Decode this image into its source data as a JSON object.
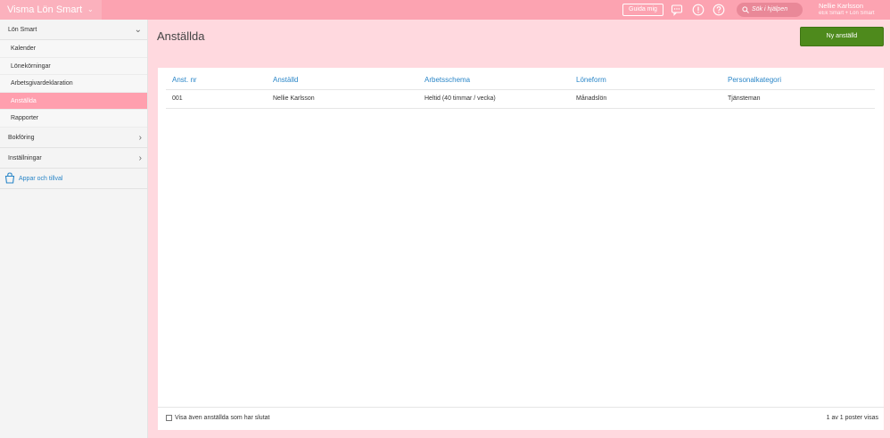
{
  "app": {
    "title": "Visma Lön Smart"
  },
  "topbar": {
    "guide_label": "Guida mig",
    "search_placeholder": "Sök i hjälpen",
    "user_name": "Nellie Karlsson",
    "user_company": "eEk Smart + Lön Smart",
    "icons": [
      "chat-icon",
      "alert-icon",
      "help-icon"
    ]
  },
  "sidebar": {
    "section_lon": "Lön Smart",
    "items": [
      "Kalender",
      "Lönekörningar",
      "Arbetsgivardeklaration",
      "Anställda",
      "Rapporter"
    ],
    "active": "Anställda",
    "section_bokforing": "Bokföring",
    "section_installningar": "Inställningar",
    "apps_label": "Appar och tillval"
  },
  "main": {
    "title": "Anställda",
    "new_button": "Ny anställd",
    "table": {
      "headers": [
        "Anst. nr",
        "Anställd",
        "Arbetsschema",
        "Löneform",
        "Personalkategori"
      ],
      "rows": [
        [
          "001",
          "Nellie Karlsson",
          "Heltid (40 timmar / vecka)",
          "Månadslön",
          "Tjänsteman"
        ]
      ]
    },
    "footer": {
      "checkbox_label": "Visa även anställda som har slutat",
      "checkbox_checked": false,
      "count_text": "1 av 1 poster visas"
    }
  },
  "colors": {
    "topbar": "#fca3b1",
    "active_item": "#ff9fae",
    "link_blue": "#2a86c8",
    "primary_button": "#4e8a1c",
    "page_background": "#ffd9df"
  }
}
